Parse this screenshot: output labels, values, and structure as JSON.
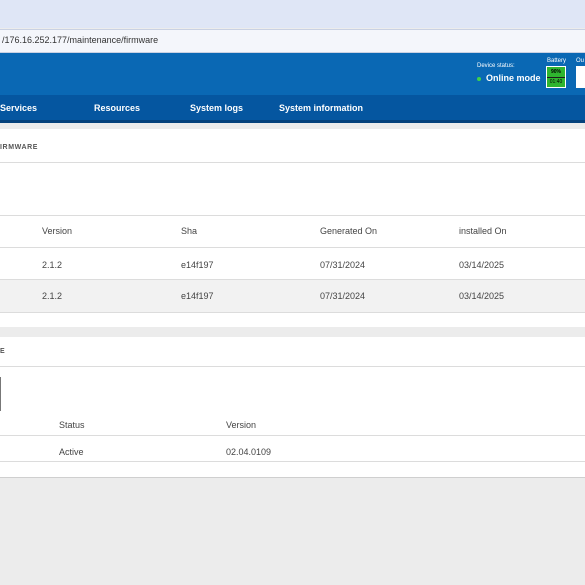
{
  "browser": {
    "url": "/176.16.252.177/maintenance/firmware"
  },
  "header": {
    "device_status_label": "Device status:",
    "device_status_value": "Online mode",
    "battery_label": "Battery",
    "battery_percent": "90%",
    "battery_time": "01:40",
    "out_label": "Ou"
  },
  "nav": {
    "items": [
      "Services",
      "Resources",
      "System logs",
      "System information"
    ]
  },
  "firmware": {
    "title": "IRMWARE",
    "columns": [
      "Version",
      "Sha",
      "Generated On",
      "installed On"
    ],
    "rows": [
      [
        "2.1.2",
        "e14f197",
        "07/31/2024",
        "03/14/2025"
      ],
      [
        "2.1.2",
        "e14f197",
        "07/31/2024",
        "03/14/2025"
      ]
    ]
  },
  "second": {
    "title": "E",
    "columns": [
      "Status",
      "Version"
    ],
    "rows": [
      [
        "Active",
        "02.04.0109"
      ]
    ]
  }
}
